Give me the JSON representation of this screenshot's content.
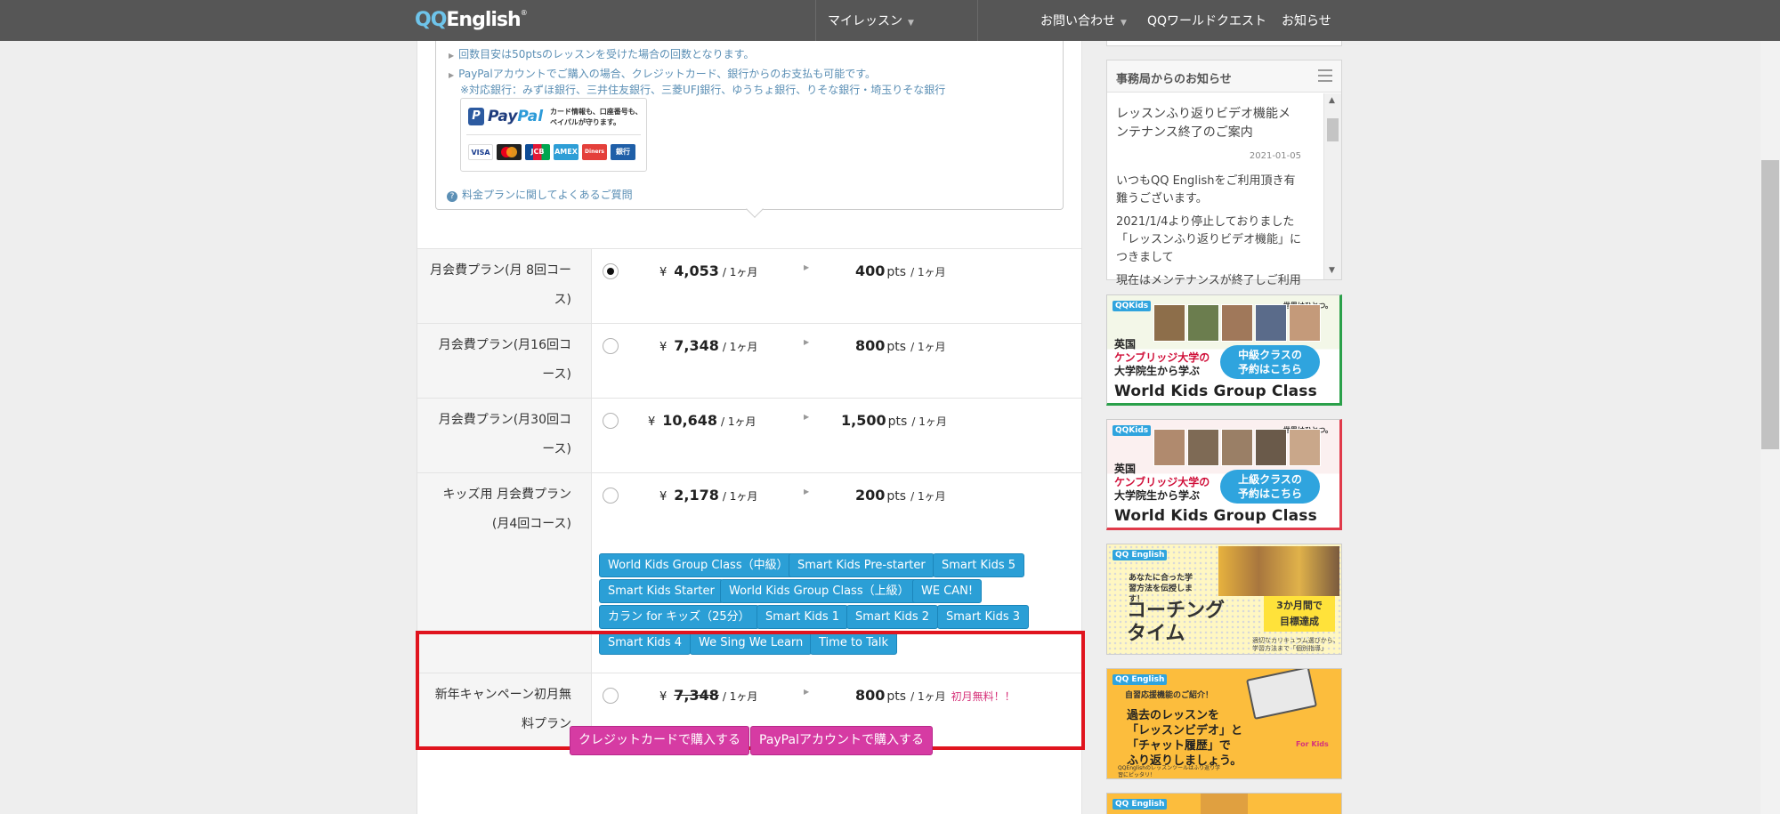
{
  "header": {
    "logo_qq": "QQ",
    "logo_english": "English",
    "logo_reg": "®",
    "my_lessons": "マイレッスン",
    "contact": "お問い合わせ",
    "world_quest": "QQワールドクエスト",
    "news": "お知らせ"
  },
  "info": {
    "note_count": "回数目安は50ptsのレッスンを受けた場合の回数となります。",
    "note_paypal": "PayPalアカウントでご購入の場合、クレジットカード、銀行からのお支払も可能です。",
    "note_banks": "※対応銀行：みずほ銀行、三井住友銀行、三菱UFJ銀行、ゆうちょ銀行、りそな銀行・埼玉りそな銀行",
    "paypal_p": "P",
    "paypal_pay": "Pay",
    "paypal_pal": "Pal",
    "paypal_tag_line1": "カード情報も、口座番号も、",
    "paypal_tag_line2": "ペイパルが守ります。",
    "card_visa": "VISA",
    "card_jcb": "JCB",
    "card_amex": "AMEX",
    "card_diners": "Diners",
    "card_bank": "銀行",
    "faq_q": "?",
    "faq": "料金プランに関してよくあるご質問"
  },
  "plans": [
    {
      "label": "月会費プラン(月 8回コース)",
      "yen": "¥",
      "price": "4,053",
      "per": "/ 1ヶ月",
      "pts": "400",
      "pts_unit": "pts",
      "pts_per": "/ 1ヶ月",
      "selected": true
    },
    {
      "label": "月会費プラン(月16回コース)",
      "yen": "¥",
      "price": "7,348",
      "per": "/ 1ヶ月",
      "pts": "800",
      "pts_unit": "pts",
      "pts_per": "/ 1ヶ月",
      "selected": false
    },
    {
      "label": "月会費プラン(月30回コース)",
      "yen": "¥",
      "price": "10,648",
      "per": "/ 1ヶ月",
      "pts": "1,500",
      "pts_unit": "pts",
      "pts_per": "/ 1ヶ月",
      "selected": false
    },
    {
      "label": "キッズ用 月会費プラン(月4回コース)",
      "yen": "¥",
      "price": "2,178",
      "per": "/ 1ヶ月",
      "pts": "200",
      "pts_unit": "pts",
      "pts_per": "/ 1ヶ月",
      "selected": false
    },
    {
      "label": "新年キャンペーン初月無料プラン",
      "yen": "¥",
      "price": "7,348",
      "per": "/ 1ヶ月",
      "pts": "800",
      "pts_unit": "pts",
      "pts_per": "/ 1ヶ月",
      "free": "初月無料！！",
      "selected": false
    }
  ],
  "kids_tags": [
    "World Kids Group Class（中級）",
    "Smart Kids Pre-starter",
    "Smart Kids 5",
    "Smart Kids Starter",
    "World Kids Group Class（上級）",
    "WE CAN!",
    "カラン for キッズ（25分）",
    "Smart Kids 1",
    "Smart Kids 2",
    "Smart Kids 3",
    "Smart Kids 4",
    "We Sing We Learn",
    "Time to Talk"
  ],
  "buttons": {
    "credit": "クレジットカードで購入する",
    "paypal": "PayPalアカウントで購入する"
  },
  "news": {
    "title": "事務局からのお知らせ",
    "headline": "レッスンふり返りビデオ機能メンテナンス終了のご案内",
    "date": "2021-01-05",
    "p1": "いつもQQ Englishをご利用頂き有難うございます。",
    "p2": "2021/1/4より停止しておりました「レッスンふり返りビデオ機能」につきまして",
    "p3": "現在はメンテナンスが終了しご利用"
  },
  "banners": {
    "kids_logo": "QQKids",
    "world_tagline": "世界はひとつ。",
    "eikoku": "英国",
    "cambridge": "ケンブリッジ大学の",
    "daigakuin": "大学院生から学ぶ",
    "mid_l1": "中級クラスの",
    "mid_l2": "予約はこちら",
    "adv_l1": "上級クラスの",
    "adv_l2": "予約はこちら",
    "wkgc": "World Kids Group Class",
    "qqe_logo": "QQ English",
    "coach_intro": "あなたに合った学習方法を伝授します！",
    "coach_title_1": "コーチング",
    "coach_title_2": "タイム",
    "coach_badge_1": "3か月間で",
    "coach_badge_2": "目標達成",
    "coach_caption": "適切なカリキュラム選びから、学習方法まで「個別指導」",
    "review_intro": "自習応援機能のご紹介！",
    "review_l1": "過去のレッスンを",
    "review_l2": "「レッスンビデオ」と",
    "review_l3": "「チャット履歴」で",
    "review_l4": "ふり返りしましょう。",
    "for_kids": "For Kids",
    "review_caption": "QQEnglishのレッスンツールはふり返り学習にピッタリ！"
  },
  "colors": {
    "header_bg": "#565656",
    "tag_blue": "#2b9fd6",
    "buy_pink": "#d63ba3",
    "highlight_red": "#e0141e",
    "link_blue": "#5b8fb5"
  }
}
